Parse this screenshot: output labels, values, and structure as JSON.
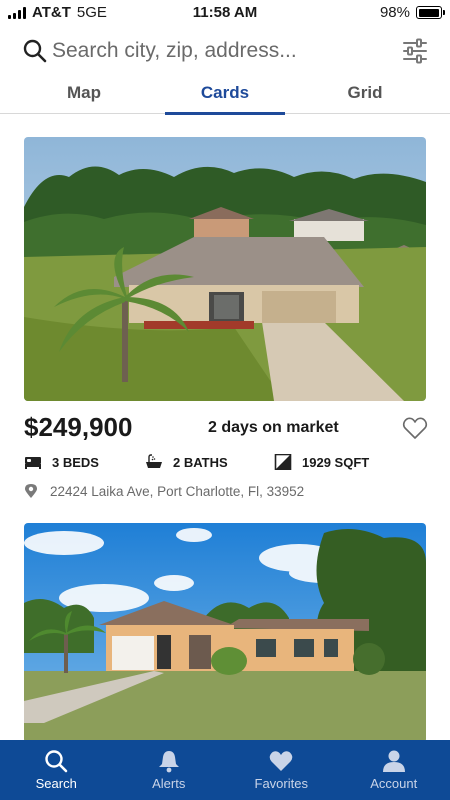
{
  "status_bar": {
    "carrier": "AT&T",
    "network": "5GE",
    "time": "11:58 AM",
    "battery": "98%"
  },
  "search": {
    "placeholder": "Search city, zip, address..."
  },
  "tabs": [
    {
      "label": "Map",
      "active": false
    },
    {
      "label": "Cards",
      "active": true
    },
    {
      "label": "Grid",
      "active": false
    }
  ],
  "listings": [
    {
      "price": "$249,900",
      "days_on_market": "2 days on market",
      "beds": "3 BEDS",
      "baths": "2 BATHS",
      "sqft": "1929 SQFT",
      "address": "22424 Laika Ave, Port Charlotte, Fl, 33952",
      "favorited": false
    }
  ],
  "bottom_nav": [
    {
      "label": "Search",
      "icon": "search-icon",
      "active": true
    },
    {
      "label": "Alerts",
      "icon": "bell-icon",
      "active": false
    },
    {
      "label": "Favorites",
      "icon": "heart-icon",
      "active": false
    },
    {
      "label": "Account",
      "icon": "person-icon",
      "active": false
    }
  ],
  "colors": {
    "brand": "#0e4a96",
    "accent": "#1e4a9a"
  }
}
